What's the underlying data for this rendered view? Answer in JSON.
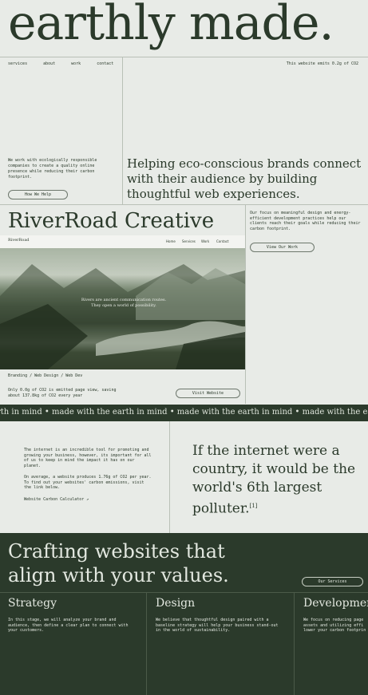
{
  "hero": {
    "title": "earthly made."
  },
  "nav": [
    "services",
    "about",
    "work",
    "contact"
  ],
  "emits": "This website emits 0.2g of CO2",
  "intro": {
    "text": "We work with ecologically responsible companies to create a quality online presence while reducing their carbon footprint.",
    "button": "How We Help"
  },
  "headline": "Helping eco-conscious brands connect with their audience by building thoughtful web experiences.",
  "project": {
    "title": "RiverRoad Creative",
    "description": "Our focus on meaningful design and energy-efficient development practices help our clients reach their goals while reducing their carbon footprint.",
    "view_button": "View Our Work",
    "shot_logo": "RiverRoad",
    "shot_nav": [
      "Home",
      "Services",
      "Work",
      "Contact"
    ],
    "shot_caption": "Rivers are ancient communication routes. They open a world of possibility.",
    "tags": "Branding / Web Design / Web Dev",
    "co2": "Only 0.0g of CO2 is emitted page view, saving about 137.8kg of CO2 every year",
    "visit_button": "Visit Website"
  },
  "band": "rth in mind • made with the earth in mind • made with the earth in mind • made with the earth in mind • made",
  "about": {
    "p1": "The internet is an incredible tool for promoting and growing your business, however, its important for all of us to keep in mind the impact it has on our planet.",
    "p2": "On average, a website produces 1.76g of CO2 per year. To find out your websites' carbon emissions, visit the link below.",
    "link": "Website Carbon Calculator ↗"
  },
  "quote": "If the internet were a country, it would be the world's 6th largest polluter.",
  "quote_ref": "[1]",
  "services": {
    "title": "Crafting websites that align with your values.",
    "button": "Our Services",
    "columns": [
      {
        "title": "Strategy",
        "text": "In this stage, we will analyze your brand and audience, then define a clear plan to connect with your customers."
      },
      {
        "title": "Design",
        "text": "We believe that thoughtful design paired with a baseline strategy will help your business stand-out in the world of sustainability."
      },
      {
        "title": "Developmen",
        "text": "We focus on reducing page assets and utilizing effi lower your carbon footprin"
      }
    ]
  }
}
